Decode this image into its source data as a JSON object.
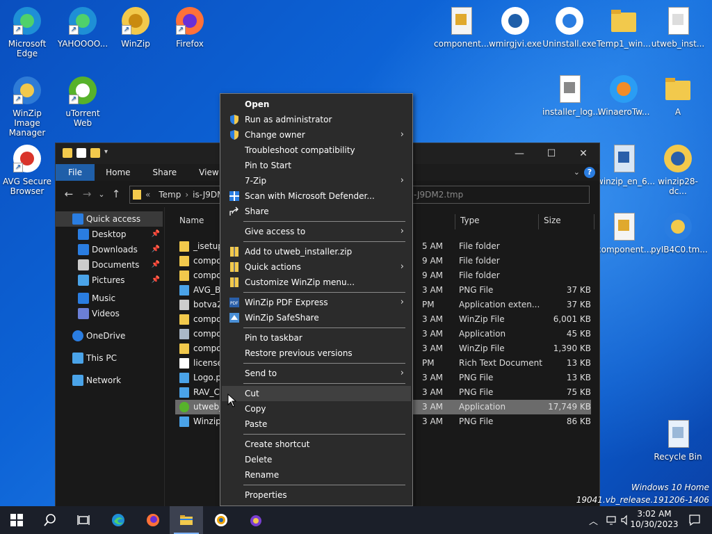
{
  "desktop_icons": [
    {
      "label": "Microsoft Edge",
      "icon": "edge-icon"
    },
    {
      "label": "YAHOOOO...",
      "icon": "edge-icon"
    },
    {
      "label": "WinZip",
      "icon": "winzip-icon"
    },
    {
      "label": "Firefox",
      "icon": "firefox-icon"
    },
    {
      "label": "WinZip Image Manager",
      "icon": "winzip-image-manager-icon"
    },
    {
      "label": "uTorrent Web",
      "icon": "utorrent-icon"
    },
    {
      "label": "AVG Secure Browser",
      "icon": "avg-browser-icon"
    },
    {
      "label": "component...",
      "icon": "zip-file-icon"
    },
    {
      "label": "wmirgjvi.exe",
      "icon": "globe-installer-icon"
    },
    {
      "label": "Uninstall.exe",
      "icon": "uninstall-icon"
    },
    {
      "label": "Temp1_win...",
      "icon": "folder-icon"
    },
    {
      "label": "utweb_inst...",
      "icon": "blank-file-icon"
    },
    {
      "label": "installer_log...",
      "icon": "text-file-icon"
    },
    {
      "label": "WinaeroTw...",
      "icon": "winaero-icon"
    },
    {
      "label": "A",
      "icon": "folder-icon"
    },
    {
      "label": "winzip_en_6...",
      "icon": "installer-icon"
    },
    {
      "label": "winzip28-dc...",
      "icon": "zip-installer-icon"
    },
    {
      "label": "component...",
      "icon": "zip-file-icon"
    },
    {
      "label": "pyIB4C0.tm...",
      "icon": "setup-icon"
    },
    {
      "label": "Recycle Bin",
      "icon": "recycle-bin-icon"
    }
  ],
  "explorer": {
    "ribbon_tabs": [
      "File",
      "Home",
      "Share",
      "View"
    ],
    "address": {
      "chevrons": "«",
      "segments": [
        "Temp",
        "is-J9DM"
      ],
      "ghost_text": "-J9DM2.tmp"
    },
    "nav": [
      {
        "label": "Quick access",
        "icon": "star-icon",
        "pinned": false
      },
      {
        "label": "Desktop",
        "icon": "desktop-icon",
        "pinned": true
      },
      {
        "label": "Downloads",
        "icon": "download-icon",
        "pinned": true
      },
      {
        "label": "Documents",
        "icon": "documents-icon",
        "pinned": true
      },
      {
        "label": "Pictures",
        "icon": "pictures-icon",
        "pinned": true
      },
      {
        "label": "Music",
        "icon": "music-icon",
        "pinned": false
      },
      {
        "label": "Videos",
        "icon": "videos-icon",
        "pinned": false
      },
      {
        "label": "OneDrive",
        "icon": "cloud-icon",
        "pinned": false
      },
      {
        "label": "This PC",
        "icon": "pc-icon",
        "pinned": false
      },
      {
        "label": "Network",
        "icon": "network-icon",
        "pinned": false
      }
    ],
    "columns": {
      "name": "Name",
      "type": "Type",
      "size": "Size"
    },
    "rows": [
      {
        "name": "_isetup",
        "date": "5 AM",
        "type": "File folder",
        "size": "",
        "icon": "folder"
      },
      {
        "name": "compo",
        "date": "9 AM",
        "type": "File folder",
        "size": "",
        "icon": "folder"
      },
      {
        "name": "compo",
        "date": "9 AM",
        "type": "File folder",
        "size": "",
        "icon": "folder"
      },
      {
        "name": "AVG_BR",
        "date": "3 AM",
        "type": "PNG File",
        "size": "37 KB",
        "icon": "png"
      },
      {
        "name": "botva2.",
        "date": "PM",
        "type": "Application exten...",
        "size": "37 KB",
        "icon": "dll"
      },
      {
        "name": "compo",
        "date": "3 AM",
        "type": "WinZip File",
        "size": "6,001 KB",
        "icon": "zip"
      },
      {
        "name": "compo",
        "date": "3 AM",
        "type": "Application",
        "size": "45 KB",
        "icon": "app"
      },
      {
        "name": "compo",
        "date": "3 AM",
        "type": "WinZip File",
        "size": "1,390 KB",
        "icon": "zip"
      },
      {
        "name": "license.",
        "date": "PM",
        "type": "Rich Text Document",
        "size": "13 KB",
        "icon": "doc"
      },
      {
        "name": "Logo.pi",
        "date": "3 AM",
        "type": "PNG File",
        "size": "13 KB",
        "icon": "png"
      },
      {
        "name": "RAV_Cr",
        "date": "3 AM",
        "type": "PNG File",
        "size": "75 KB",
        "icon": "png"
      },
      {
        "name": "utweb_",
        "date": "3 AM",
        "type": "Application",
        "size": "17,749 KB",
        "icon": "utorrent"
      },
      {
        "name": "Winzip1",
        "date": "3 AM",
        "type": "PNG File",
        "size": "86 KB",
        "icon": "png"
      }
    ]
  },
  "context_menu": [
    {
      "label": "Open",
      "bold": true,
      "icon": "",
      "submenu": false
    },
    {
      "label": "Run as administrator",
      "icon": "uac-shield-icon",
      "submenu": false
    },
    {
      "label": "Change owner",
      "icon": "uac-shield-icon",
      "submenu": true
    },
    {
      "label": "Troubleshoot compatibility",
      "icon": "",
      "submenu": false
    },
    {
      "label": "Pin to Start",
      "icon": "",
      "submenu": false
    },
    {
      "label": "7-Zip",
      "icon": "",
      "submenu": true
    },
    {
      "label": "Scan with Microsoft Defender...",
      "icon": "defender-icon",
      "submenu": false
    },
    {
      "label": "Share",
      "icon": "share-icon",
      "submenu": false
    },
    {
      "sep": true
    },
    {
      "label": "Give access to",
      "icon": "",
      "submenu": true
    },
    {
      "sep": true
    },
    {
      "label": "Add to utweb_installer.zip",
      "icon": "winzip-small-icon",
      "submenu": false
    },
    {
      "label": "Quick actions",
      "icon": "winzip-small-icon",
      "submenu": true
    },
    {
      "label": "Customize WinZip menu...",
      "icon": "winzip-small-icon",
      "submenu": false
    },
    {
      "sep": true
    },
    {
      "label": "WinZip PDF Express",
      "icon": "pdf-icon",
      "submenu": true
    },
    {
      "label": "WinZip SafeShare",
      "icon": "safeshare-icon",
      "submenu": false
    },
    {
      "sep": true
    },
    {
      "label": "Pin to taskbar",
      "icon": "",
      "submenu": false
    },
    {
      "label": "Restore previous versions",
      "icon": "",
      "submenu": false
    },
    {
      "sep": true
    },
    {
      "label": "Send to",
      "icon": "",
      "submenu": true
    },
    {
      "sep": true
    },
    {
      "label": "Cut",
      "icon": "",
      "submenu": false,
      "hover": true
    },
    {
      "label": "Copy",
      "icon": "",
      "submenu": false
    },
    {
      "label": "Paste",
      "icon": "",
      "submenu": false
    },
    {
      "sep": true
    },
    {
      "label": "Create shortcut",
      "icon": "",
      "submenu": false
    },
    {
      "label": "Delete",
      "icon": "",
      "submenu": false
    },
    {
      "label": "Rename",
      "icon": "",
      "submenu": false
    },
    {
      "sep": true
    },
    {
      "label": "Properties",
      "icon": "",
      "submenu": false
    }
  ],
  "taskbar": {
    "clock_time": "3:02 AM",
    "clock_date": "10/30/2023"
  },
  "watermark": {
    "line1": "Windows 10 Home",
    "line2": "19041.vb_release.191206-1406"
  },
  "colors": {
    "accent": "#1f5fa9",
    "menu_bg": "#2b2b2b",
    "explorer_bg": "#191919",
    "taskbar": "#1b1f29"
  }
}
